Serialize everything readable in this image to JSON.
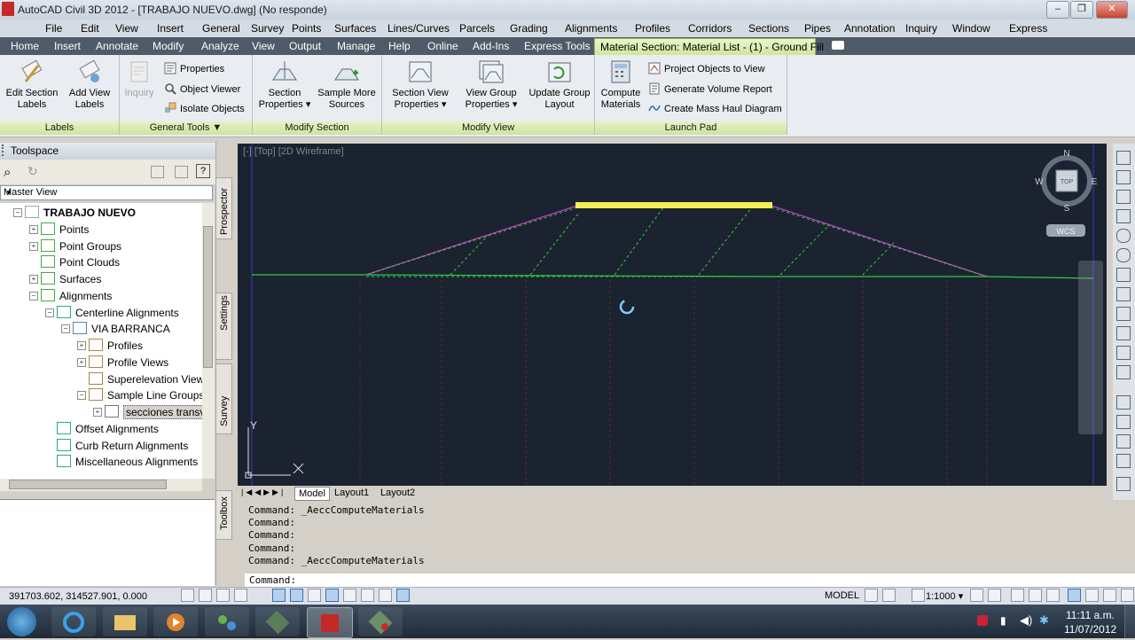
{
  "window": {
    "title": "AutoCAD Civil 3D 2012 - [TRABAJO NUEVO.dwg] (No responde)",
    "min": "–",
    "max": "❐",
    "close": "✕"
  },
  "menu": [
    "File",
    "Edit",
    "View",
    "Insert",
    "General",
    "Survey",
    "Points",
    "Surfaces",
    "Lines/Curves",
    "Parcels",
    "Grading",
    "Alignments",
    "Profiles",
    "Corridors",
    "Sections",
    "Pipes",
    "Annotation",
    "Inquiry",
    "Window",
    "Express"
  ],
  "ribbon_tabs": [
    "Home",
    "Insert",
    "Annotate",
    "Modify",
    "Analyze",
    "View",
    "Output",
    "Manage",
    "Help",
    "Online",
    "Add-Ins",
    "Express Tools"
  ],
  "contextual_tab": "Material Section: Material List - (1) - Ground Fill",
  "panels": {
    "labels": {
      "title": "Labels",
      "edit_section_labels": [
        "Edit Section",
        "Labels"
      ],
      "add_view_labels": [
        "Add View",
        "Labels"
      ]
    },
    "general_tools": {
      "title": "General Tools ▼",
      "inquiry": "Inquiry",
      "properties": "Properties",
      "object_viewer": "Object Viewer",
      "isolate_objects": "Isolate Objects"
    },
    "modify_section": {
      "title": "Modify Section",
      "section_properties": [
        "Section",
        "Properties"
      ],
      "sample_more_sources": [
        "Sample More",
        "Sources"
      ]
    },
    "modify_view": {
      "title": "Modify View",
      "section_view_properties": [
        "Section View",
        "Properties"
      ],
      "view_group_properties": [
        "View Group",
        "Properties"
      ],
      "update_group_layout": [
        "Update Group",
        "Layout"
      ]
    },
    "launch_pad": {
      "title": "Launch Pad",
      "compute_materials": [
        "Compute",
        "Materials"
      ],
      "project_objects": "Project Objects to View",
      "volume_report": "Generate Volume Report",
      "mass_haul": "Create Mass Haul Diagram"
    }
  },
  "toolspace": {
    "title": "Toolspace",
    "view_combo": "Master View",
    "tree": [
      {
        "label": "TRABAJO NUEVO",
        "level": 0,
        "bold": true,
        "exp": "−"
      },
      {
        "label": "Points",
        "level": 1,
        "exp": "+"
      },
      {
        "label": "Point Groups",
        "level": 1,
        "exp": "+"
      },
      {
        "label": "Point Clouds",
        "level": 1,
        "exp": ""
      },
      {
        "label": "Surfaces",
        "level": 1,
        "exp": "+"
      },
      {
        "label": "Alignments",
        "level": 1,
        "exp": "−"
      },
      {
        "label": "Centerline Alignments",
        "level": 2,
        "exp": "−"
      },
      {
        "label": "VIA BARRANCA",
        "level": 3,
        "exp": "−"
      },
      {
        "label": "Profiles",
        "level": 4,
        "exp": "+"
      },
      {
        "label": "Profile Views",
        "level": 4,
        "exp": "+"
      },
      {
        "label": "Superelevation Views",
        "level": 4,
        "exp": ""
      },
      {
        "label": "Sample Line Groups",
        "level": 4,
        "exp": "−"
      },
      {
        "label": "secciones transver...",
        "level": 5,
        "exp": "+",
        "selected": true
      },
      {
        "label": "Offset Alignments",
        "level": 2,
        "exp": ""
      },
      {
        "label": "Curb Return Alignments",
        "level": 2,
        "exp": ""
      },
      {
        "label": "Miscellaneous Alignments",
        "level": 2,
        "exp": ""
      }
    ],
    "vtabs": [
      "Prospector",
      "Settings",
      "Survey",
      "Toolbox"
    ]
  },
  "viewport": {
    "label": "[-] [Top] [2D Wireframe]",
    "compass": {
      "n": "N",
      "s": "S",
      "e": "E",
      "w": "W",
      "top": "TOP",
      "wcs": "WCS"
    },
    "axis_y": "Y"
  },
  "layout_tabs": [
    "Model",
    "Layout1",
    "Layout2"
  ],
  "command_history": [
    "Command: _AeccComputeMaterials",
    "Command:",
    "Command:",
    "Command:",
    "Command: _AeccComputeMaterials"
  ],
  "command_prompt": "Command:",
  "status": {
    "coords": "391703.602, 314527.901, 0.000",
    "model": "MODEL",
    "scale": "1:1000 ▾"
  },
  "clock": {
    "time": "11:11 a.m.",
    "date": "11/07/2012"
  },
  "colors": {
    "accent_green": "#cfe59a",
    "canvas": "#1c2330",
    "ground": "#2ecc40",
    "design": "#d23cd2",
    "road": "#f0f050"
  }
}
